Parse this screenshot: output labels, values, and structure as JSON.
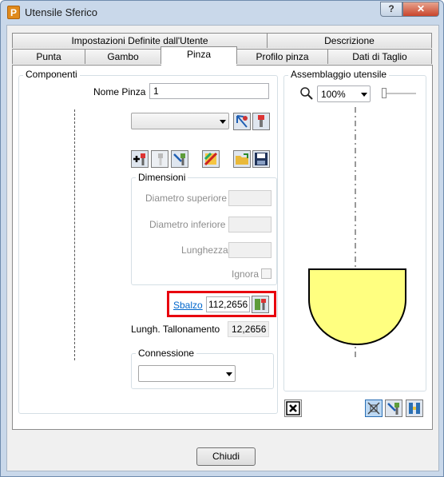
{
  "window": {
    "title": "Utensile Sferico",
    "app_icon_letter": "P",
    "help_label": "?",
    "close_label": "✕"
  },
  "tabs_row1": [
    "Impostazioni Definite dall'Utente",
    "Descrizione"
  ],
  "tabs_row2": [
    "Punta",
    "Gambo",
    "Pinza",
    "Profilo pinza",
    "Dati di Taglio"
  ],
  "active_tab": "Pinza",
  "componenti": {
    "title": "Componenti",
    "nome_pinza_label": "Nome Pinza",
    "nome_pinza_value": "1",
    "component_select_value": "",
    "dimensioni": {
      "title": "Dimensioni",
      "diametro_superiore_label": "Diametro superiore",
      "diametro_inferiore_label": "Diametro inferiore",
      "lunghezza_label": "Lunghezza",
      "ignora_label": "Ignora"
    },
    "sbalzo_label": "Sbalzo",
    "sbalzo_value": "112,2656",
    "lungh_tallonamento_label": "Lungh. Tallonamento",
    "lungh_tallonamento_value": "12,2656",
    "connessione": {
      "title": "Connessione",
      "value": ""
    }
  },
  "assemblaggio": {
    "title": "Assemblaggio utensile",
    "zoom_value": "100%",
    "zoom_slider_level": 0,
    "tool_fill_color": "#ffff80"
  },
  "footer": {
    "close_button_label": "Chiudi"
  },
  "colors": {
    "highlight": "#e8000e",
    "link": "#0066cc"
  }
}
